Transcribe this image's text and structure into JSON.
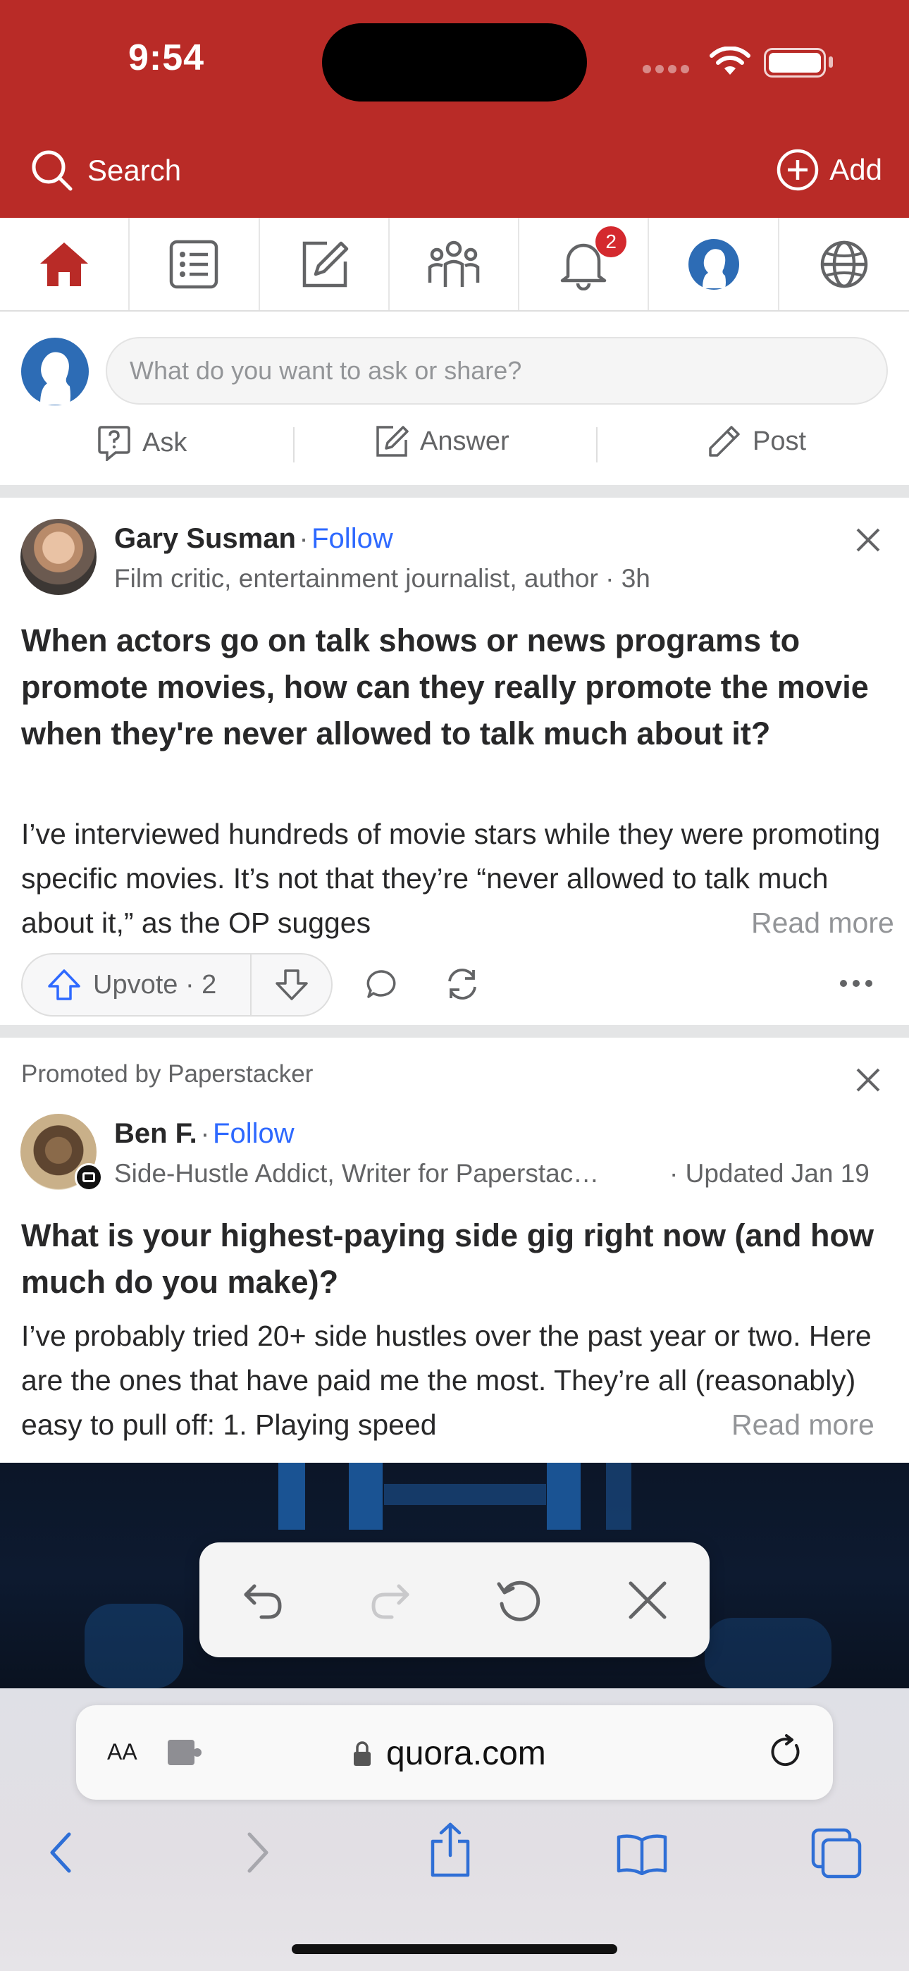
{
  "status_bar": {
    "time": "9:54"
  },
  "header": {
    "search_label": "Search",
    "add_label": "Add",
    "accent": "#b92b27"
  },
  "nav": {
    "notifications_badge": "2",
    "icons": [
      "home-icon",
      "list-icon",
      "edit-icon",
      "spaces-icon",
      "bell-icon",
      "avatar-icon",
      "globe-icon"
    ]
  },
  "composer": {
    "placeholder": "What do you want to ask or share?",
    "ask_label": "Ask",
    "answer_label": "Answer",
    "post_label": "Post"
  },
  "feed": [
    {
      "author": "Gary Susman",
      "follow_label": "Follow",
      "credential": "Film critic, entertainment journalist, author · 3h",
      "question": "When actors go on talk shows or news programs to promote movies, how can they really promote the movie when they're never allowed to talk much about it?",
      "body": "I’ve interviewed hundreds of movie stars while they were promoting specific movies. It’s not that they’re “never allowed to talk much about it,” as the OP sugges",
      "read_more": "Read more",
      "upvote_label": "Upvote · 2"
    },
    {
      "promoted": "Promoted by Paperstacker",
      "author": "Ben F.",
      "follow_label": "Follow",
      "credential": "Side-Hustle Addict, Writer for Paperstac…",
      "updated": "· Updated Jan 19",
      "question": "What is your highest-paying side gig right now (and how much do you make)?",
      "body": "I’ve probably tried 20+ side hustles over the past year or two. Here are the ones that have paid me the most. They’re all (reasonably) easy to pull off: 1. Playing speed",
      "read_more": "Read more"
    }
  ],
  "safari": {
    "aa_label": "AA",
    "url": "quora.com"
  }
}
